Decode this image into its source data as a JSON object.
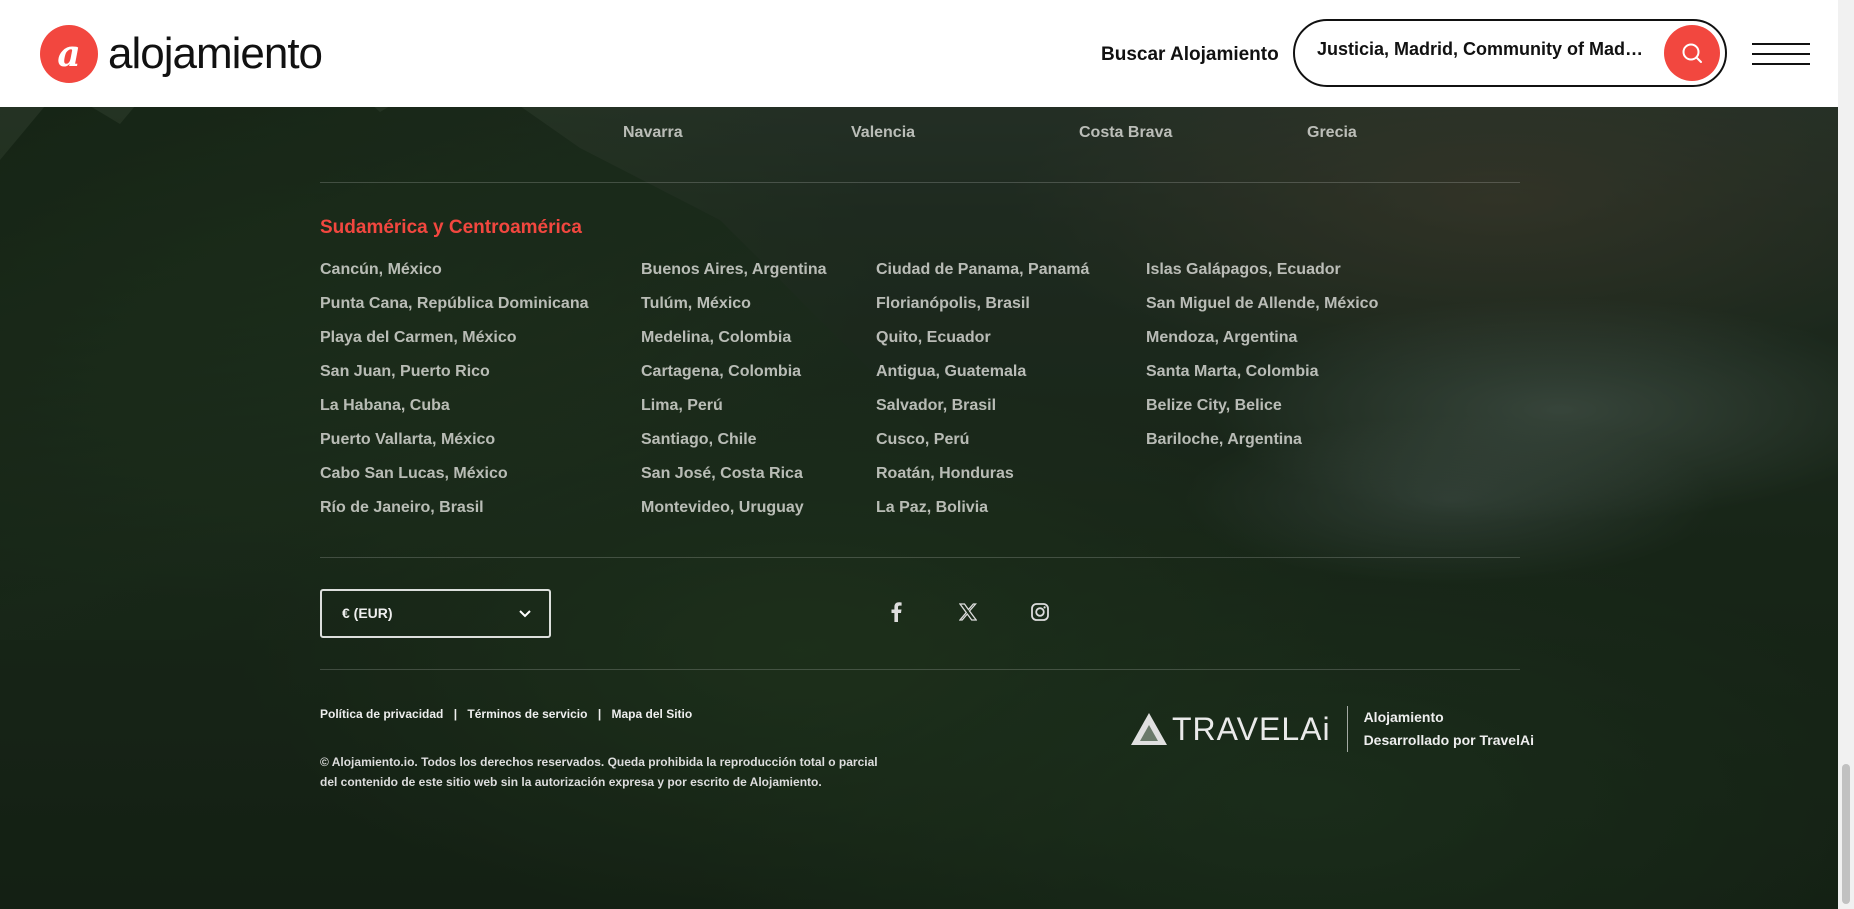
{
  "header": {
    "logo_letter": "a",
    "logo_text": "alojamiento",
    "nav_link": "Buscar Alojamiento",
    "search_value": "Justicia, Madrid, Community of Madri...",
    "icons": {
      "search": "search-icon",
      "menu": "hamburger-menu-icon"
    },
    "accent_color": "#f2473f"
  },
  "europe_row": [
    "Navarra",
    "Valencia",
    "Costa Brava",
    "Grecia"
  ],
  "south_america": {
    "title": "Sudamérica y Centroamérica",
    "columns": [
      [
        "Cancún, México",
        "Punta Cana, República Dominicana",
        "Playa del Carmen, México",
        "San Juan, Puerto Rico",
        "La Habana, Cuba",
        "Puerto Vallarta, México",
        "Cabo San Lucas, México",
        "Río de Janeiro, Brasil"
      ],
      [
        "Buenos Aires, Argentina",
        "Tulúm, México",
        "Medelina, Colombia",
        "Cartagena, Colombia",
        "Lima, Perú",
        "Santiago, Chile",
        "San José, Costa Rica",
        "Montevideo, Uruguay"
      ],
      [
        "Ciudad de Panama, Panamá",
        "Florianópolis, Brasil",
        "Quito, Ecuador",
        "Antigua, Guatemala",
        "Salvador, Brasil",
        "Cusco, Perú",
        "Roatán, Honduras",
        "La Paz, Bolivia"
      ],
      [
        "Islas Galápagos, Ecuador",
        "San Miguel de Allende, México",
        "Mendoza, Argentina",
        "Santa Marta, Colombia",
        "Belize City, Belice",
        "Bariloche, Argentina"
      ]
    ]
  },
  "footer": {
    "currency": "€ (EUR)",
    "social_icons": [
      "facebook-icon",
      "x-icon",
      "instagram-icon"
    ],
    "legal": {
      "privacy": "Política de privacidad",
      "terms": "Términos de servicio",
      "sitemap": "Mapa del Sitio",
      "separator": "|"
    },
    "copyright_line1": "© Alojamiento.io. Todos los derechos reservados. Queda prohibida la reproducción total o parcial",
    "copyright_line2": "del contenido de este sitio web sin la autorización expresa y por escrito de Alojamiento.",
    "brand_logo": "TRAVELAi",
    "brand_line1": "Alojamiento",
    "brand_line2": "Desarrollado por TravelAi"
  }
}
